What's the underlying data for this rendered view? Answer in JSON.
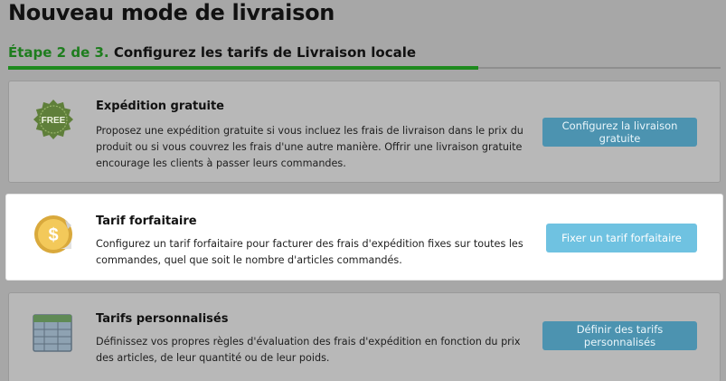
{
  "header": {
    "title": "Nouveau mode de livraison",
    "step_label": "Étape 2 de 3.",
    "step_text": "Configurez les tarifs de Livraison locale"
  },
  "progress": {
    "fraction": 0.667
  },
  "options": [
    {
      "title": "Expédition gratuite",
      "description": "Proposez une expédition gratuite si vous incluez les frais de livraison dans le prix du produit ou si vous couvrez les frais d'une autre manière. Offrir une livraison gratuite encourage les clients à passer leurs commandes.",
      "button": "Configurez la livraison gratuite",
      "icon": "free-badge-icon",
      "icon_text": "FREE"
    },
    {
      "title": "Tarif forfaitaire",
      "description": "Configurez un tarif forfaitaire pour facturer des frais d'expédition fixes sur toutes les commandes, quel que soit le nombre d'articles commandés.",
      "button": "Fixer un tarif forfaitaire",
      "icon": "dollar-coin-icon",
      "icon_text": "$"
    },
    {
      "title": "Tarifs personnalisés",
      "description": "Définissez vos propres règles d'évaluation des frais d'expédition en fonction du prix des articles, de leur quantité ou de leur poids.",
      "button": "Définir des tarifs personnalisés",
      "icon": "rate-table-icon"
    }
  ],
  "colors": {
    "step_green": "#1e7d1e",
    "progress_green": "#1e8a1e",
    "button_blue": "#6fc2e1",
    "button_blue_muted": "#4c93b0",
    "overlay_gray": "#a7a7a7"
  }
}
